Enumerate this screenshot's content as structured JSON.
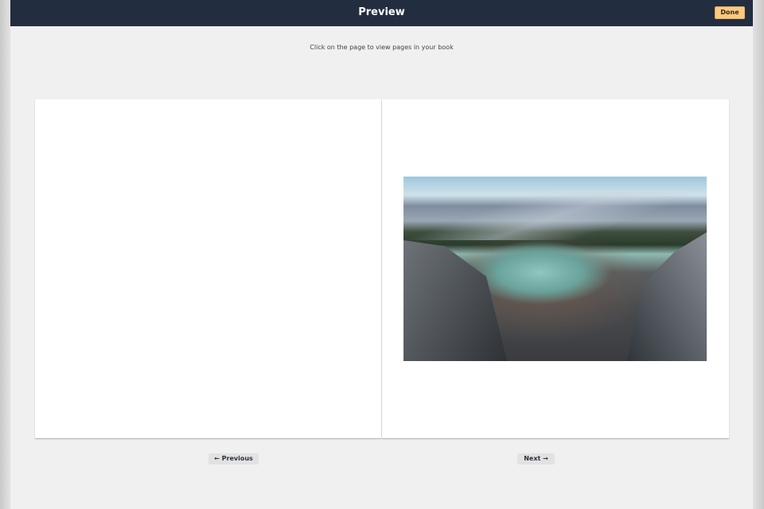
{
  "header": {
    "title": "Preview",
    "done_label": "Done"
  },
  "hint": "Click on the page to view pages in your book",
  "spread": {
    "right_page_image": "mountain lake photo"
  },
  "nav": {
    "previous_label": "← Previous",
    "next_label": "Next →"
  },
  "colors": {
    "header_bg": "#222d40",
    "done_bg": "#fcc980"
  }
}
